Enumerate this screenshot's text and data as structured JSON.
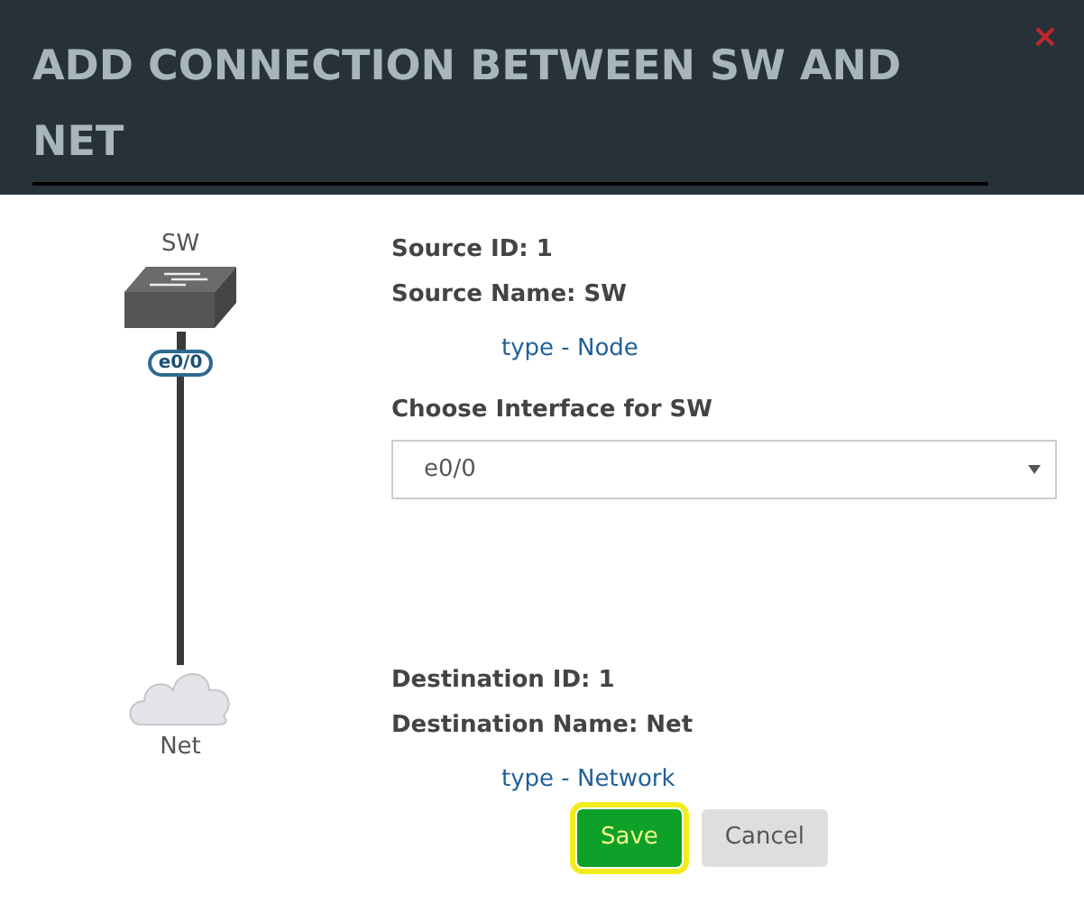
{
  "dialog": {
    "title": "ADD CONNECTION BETWEEN SW AND NET",
    "close": "×"
  },
  "diagram": {
    "source": {
      "label": "SW",
      "interface": "e0/0"
    },
    "destination": {
      "label": "Net"
    }
  },
  "source": {
    "id": "Source ID: 1",
    "name": "Source Name: SW",
    "type": "type - Node",
    "interface_label": "Choose Interface for SW",
    "interface_value": "e0/0"
  },
  "destination": {
    "id": "Destination ID: 1",
    "name": "Destination Name: Net",
    "type": "type - Network"
  },
  "buttons": [
    {
      "label": "Save",
      "kind": "primary",
      "focused": true
    },
    {
      "label": "Cancel",
      "kind": "secondary",
      "focused": false
    }
  ]
}
